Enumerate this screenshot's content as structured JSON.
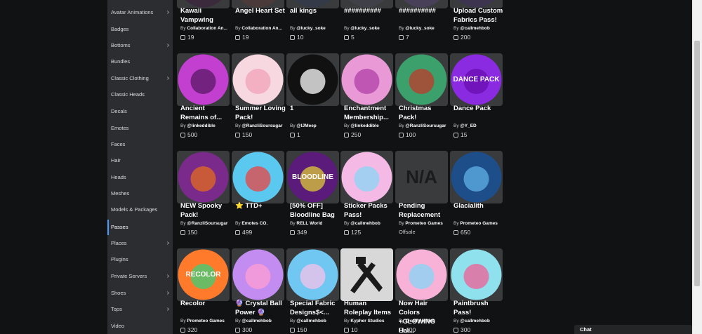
{
  "sidebar": {
    "items": [
      {
        "label": "Avatar Animations",
        "chevron": true,
        "active": false
      },
      {
        "label": "Badges",
        "chevron": false,
        "active": false
      },
      {
        "label": "Bottoms",
        "chevron": true,
        "active": false
      },
      {
        "label": "Bundles",
        "chevron": false,
        "active": false
      },
      {
        "label": "Classic Clothing",
        "chevron": true,
        "active": false
      },
      {
        "label": "Classic Heads",
        "chevron": false,
        "active": false
      },
      {
        "label": "Decals",
        "chevron": false,
        "active": false
      },
      {
        "label": "Emotes",
        "chevron": false,
        "active": false
      },
      {
        "label": "Faces",
        "chevron": false,
        "active": false
      },
      {
        "label": "Hair",
        "chevron": false,
        "active": false
      },
      {
        "label": "Heads",
        "chevron": false,
        "active": false
      },
      {
        "label": "Meshes",
        "chevron": false,
        "active": false
      },
      {
        "label": "Models & Packages",
        "chevron": false,
        "active": false
      },
      {
        "label": "Passes",
        "chevron": false,
        "active": true
      },
      {
        "label": "Places",
        "chevron": true,
        "active": false
      },
      {
        "label": "Plugins",
        "chevron": false,
        "active": false
      },
      {
        "label": "Private Servers",
        "chevron": true,
        "active": false
      },
      {
        "label": "Shoes",
        "chevron": true,
        "active": false
      },
      {
        "label": "Tops",
        "chevron": true,
        "active": false
      },
      {
        "label": "Video",
        "chevron": false,
        "active": false
      }
    ]
  },
  "items": [
    {
      "name": "Kawaii Vampwing",
      "by_prefix": "By ",
      "creator": "Collaboration An...",
      "price": "19",
      "thumb": "#3a2a3c"
    },
    {
      "name": "Angel Heart Set",
      "by_prefix": "By ",
      "creator": "Collaboration An...",
      "price": "19",
      "thumb": "#4a3a3a"
    },
    {
      "name": "all kings",
      "by_prefix": "By ",
      "creator": "@lucky_soke",
      "price": "10",
      "thumb": "#343a48"
    },
    {
      "name": "##########",
      "by_prefix": "By ",
      "creator": "@lucky_soke",
      "price": "5",
      "thumb": "#404048"
    },
    {
      "name": "##########",
      "by_prefix": "By ",
      "creator": "@lucky_soke",
      "price": "7",
      "thumb": "#484058"
    },
    {
      "name": "Upload Custom Fabrics Pass!",
      "by_prefix": "By ",
      "creator": "@callmehbob",
      "price": "200",
      "thumb": "#3d3450"
    },
    {
      "name": "Ancient Remains of...",
      "by_prefix": "By ",
      "creator": "@linkeddible",
      "price": "500",
      "thumb": "#c23fd0",
      "inner": "#5a1a66"
    },
    {
      "name": "Summer Loving Pack!",
      "by_prefix": "By ",
      "creator": "@RanzliSoursugar",
      "price": "150",
      "thumb": "#f7d8e0",
      "inner": "#f2a3b8"
    },
    {
      "name": "1",
      "by_prefix": "By ",
      "creator": "@IJMeep",
      "price": "1",
      "thumb": "#111111",
      "inner": "#ffffff"
    },
    {
      "name": "Enchantment Membership...",
      "by_prefix": "By ",
      "creator": "@linkeddible",
      "price": "250",
      "thumb": "#e99ad6",
      "inner": "#b23fa8"
    },
    {
      "name": "Christmas Pack!",
      "by_prefix": "By ",
      "creator": "@RanzliSoursugar",
      "price": "100",
      "thumb": "#3ba06b",
      "inner": "#c0392b"
    },
    {
      "name": "Dance Pack",
      "by_prefix": "By ",
      "creator": "@Y_ED",
      "price": "15",
      "thumb": "#8a2be2",
      "inner": "#6a0dad",
      "text": "DANCE PACK"
    },
    {
      "name": "NEW Spooky Pack!",
      "by_prefix": "By ",
      "creator": "@RanzliSoursugar",
      "price": "150",
      "thumb": "#7a2a8a",
      "inner": "#e36b1e"
    },
    {
      "name": "⭐ TTD+",
      "by_prefix": "By ",
      "creator": "Emotes CO.",
      "price": "499",
      "thumb": "#5bc9ef",
      "inner": "#e94343"
    },
    {
      "name": "[50% OFF] Bloodline Bag",
      "by_prefix": "By ",
      "creator": "RELL World",
      "price": "349",
      "thumb": "#5a1b7a",
      "inner": "#e0c93a",
      "text": "BLOODLINE"
    },
    {
      "name": "Sticker Packs Pass!",
      "by_prefix": "By ",
      "creator": "@callmehbob",
      "price": "125",
      "thumb": "#f5b9e6",
      "inner": "#8ad7f3"
    },
    {
      "name": "Pending Replacement",
      "by_prefix": "By ",
      "creator": "Prometeo Games",
      "price": "",
      "offsale": "Offsale",
      "thumb": "#393b3d",
      "inner": "#393b3d",
      "text": "N/A",
      "square": true
    },
    {
      "name": "Glacialith",
      "by_prefix": "By ",
      "creator": "Prometeo Games",
      "price": "650",
      "thumb": "#1d4e8a",
      "inner": "#5fb0e6"
    },
    {
      "name": "Recolor",
      "by_prefix": "By ",
      "creator": "Prometeo Games",
      "price": "320",
      "thumb": "#ff7a2a",
      "inner": "#3ad17a",
      "text": "RECOLOR"
    },
    {
      "name": "🔮 Crystal Ball Power 🔮",
      "by_prefix": "By ",
      "creator": "@callmehbob",
      "price": "300",
      "thumb": "#c38cf0",
      "inner": "#ff9fd6"
    },
    {
      "name": "Special Fabric Designs$<...",
      "by_prefix": "By ",
      "creator": "@callmehbob",
      "price": "150",
      "thumb": "#6fc7f2",
      "inner": "#f5c1e8"
    },
    {
      "name": "Human Roleplay Items",
      "by_prefix": "By ",
      "creator": "Kypher Studios",
      "price": "10",
      "thumb": "#d8d8d8",
      "inner": "#1a1a1a",
      "square": true
    },
    {
      "name": "Now Hair Colors +GLOWING Hai...",
      "by_prefix": "By ",
      "creator": "@callmehbob",
      "price": "100",
      "thumb": "#f8b2d8",
      "inner": "#86d6f5"
    },
    {
      "name": "Paintbrush Pass!",
      "by_prefix": "By ",
      "creator": "@callmehbob",
      "price": "300",
      "thumb": "#8fe1ee",
      "inner": "#f05e96"
    }
  ],
  "chat": {
    "label": "Chat"
  }
}
